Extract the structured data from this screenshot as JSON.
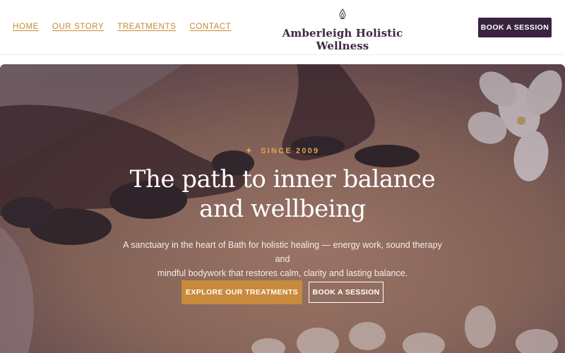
{
  "nav": {
    "items": [
      {
        "label": "HOME"
      },
      {
        "label": "OUR STORY"
      },
      {
        "label": "TREATMENTS"
      },
      {
        "label": "CONTACT"
      }
    ]
  },
  "brand": {
    "name": "Amberleigh Holistic Wellness",
    "icon": "lotus-drop-icon"
  },
  "header": {
    "book_label": "BOOK A SESSION"
  },
  "hero": {
    "eyebrow_symbol": "✦",
    "eyebrow": "SINCE 2009",
    "headline_line1": "The path to inner balance",
    "headline_line2": "and wellbeing",
    "subtext_line1": "A sanctuary in the heart of Bath for holistic healing — energy work, sound therapy and",
    "subtext_line2": "mindful bodywork that restores calm, clarity and lasting balance.",
    "primary_label": "EXPLORE OUR TREATMENTS",
    "secondary_label": "BOOK A SESSION"
  },
  "colors": {
    "accent": "#c88a3c",
    "brand": "#3a2340",
    "eyebrow": "#e0a24c"
  }
}
